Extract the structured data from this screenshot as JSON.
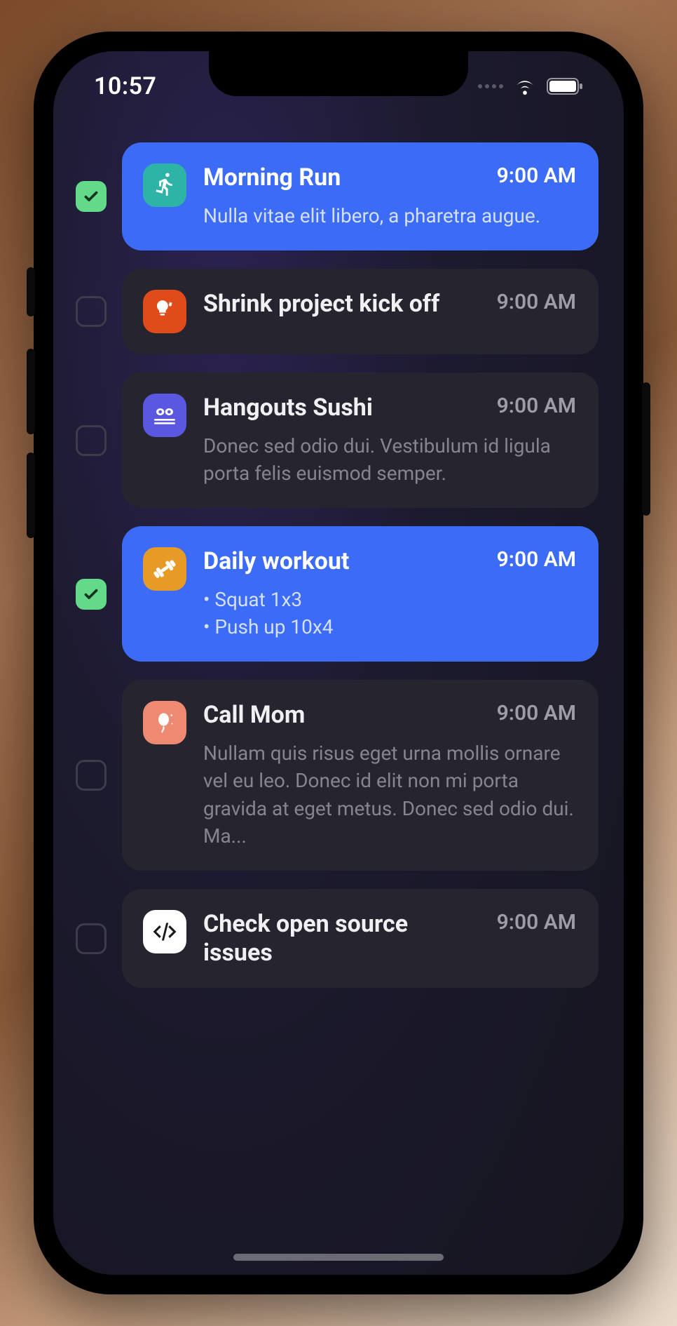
{
  "status": {
    "time": "10:57"
  },
  "tasks": [
    {
      "checked": true,
      "selected": true,
      "icon": {
        "name": "runner-icon",
        "bg": "#2eb3a7",
        "fg": "#ffffff"
      },
      "title": "Morning Run",
      "time": "9:00 AM",
      "description": "Nulla vitae elit libero, a pharetra augue."
    },
    {
      "checked": false,
      "selected": false,
      "icon": {
        "name": "bulb-gear-icon",
        "bg": "#e04b1a",
        "fg": "#ffffff"
      },
      "title": "Shrink project kick off",
      "time": "9:00 AM",
      "description": ""
    },
    {
      "checked": false,
      "selected": false,
      "icon": {
        "name": "sushi-icon",
        "bg": "#5a57e0",
        "fg": "#ffffff"
      },
      "title": "Hangouts Sushi",
      "time": "9:00 AM",
      "description": "Donec sed odio dui. Vestibulum id ligula porta felis euismod semper."
    },
    {
      "checked": true,
      "selected": true,
      "icon": {
        "name": "dumbbell-icon",
        "bg": "#e89a26",
        "fg": "#ffffff"
      },
      "title": "Daily workout",
      "time": "9:00 AM",
      "description": " • Squat 1x3\n • Push up 10x4"
    },
    {
      "checked": false,
      "selected": false,
      "icon": {
        "name": "balloon-icon",
        "bg": "#ef8a72",
        "fg": "#ffffff"
      },
      "title": "Call Mom",
      "time": "9:00 AM",
      "description": "Nullam quis risus eget urna mollis ornare vel eu leo. Donec id elit non mi porta gravida at eget metus. Donec sed odio dui. Ma..."
    },
    {
      "checked": false,
      "selected": false,
      "icon": {
        "name": "code-icon",
        "bg": "#ffffff",
        "fg": "#1a1a1a"
      },
      "title": "Check open source issues",
      "time": "9:00 AM",
      "description": ""
    }
  ]
}
